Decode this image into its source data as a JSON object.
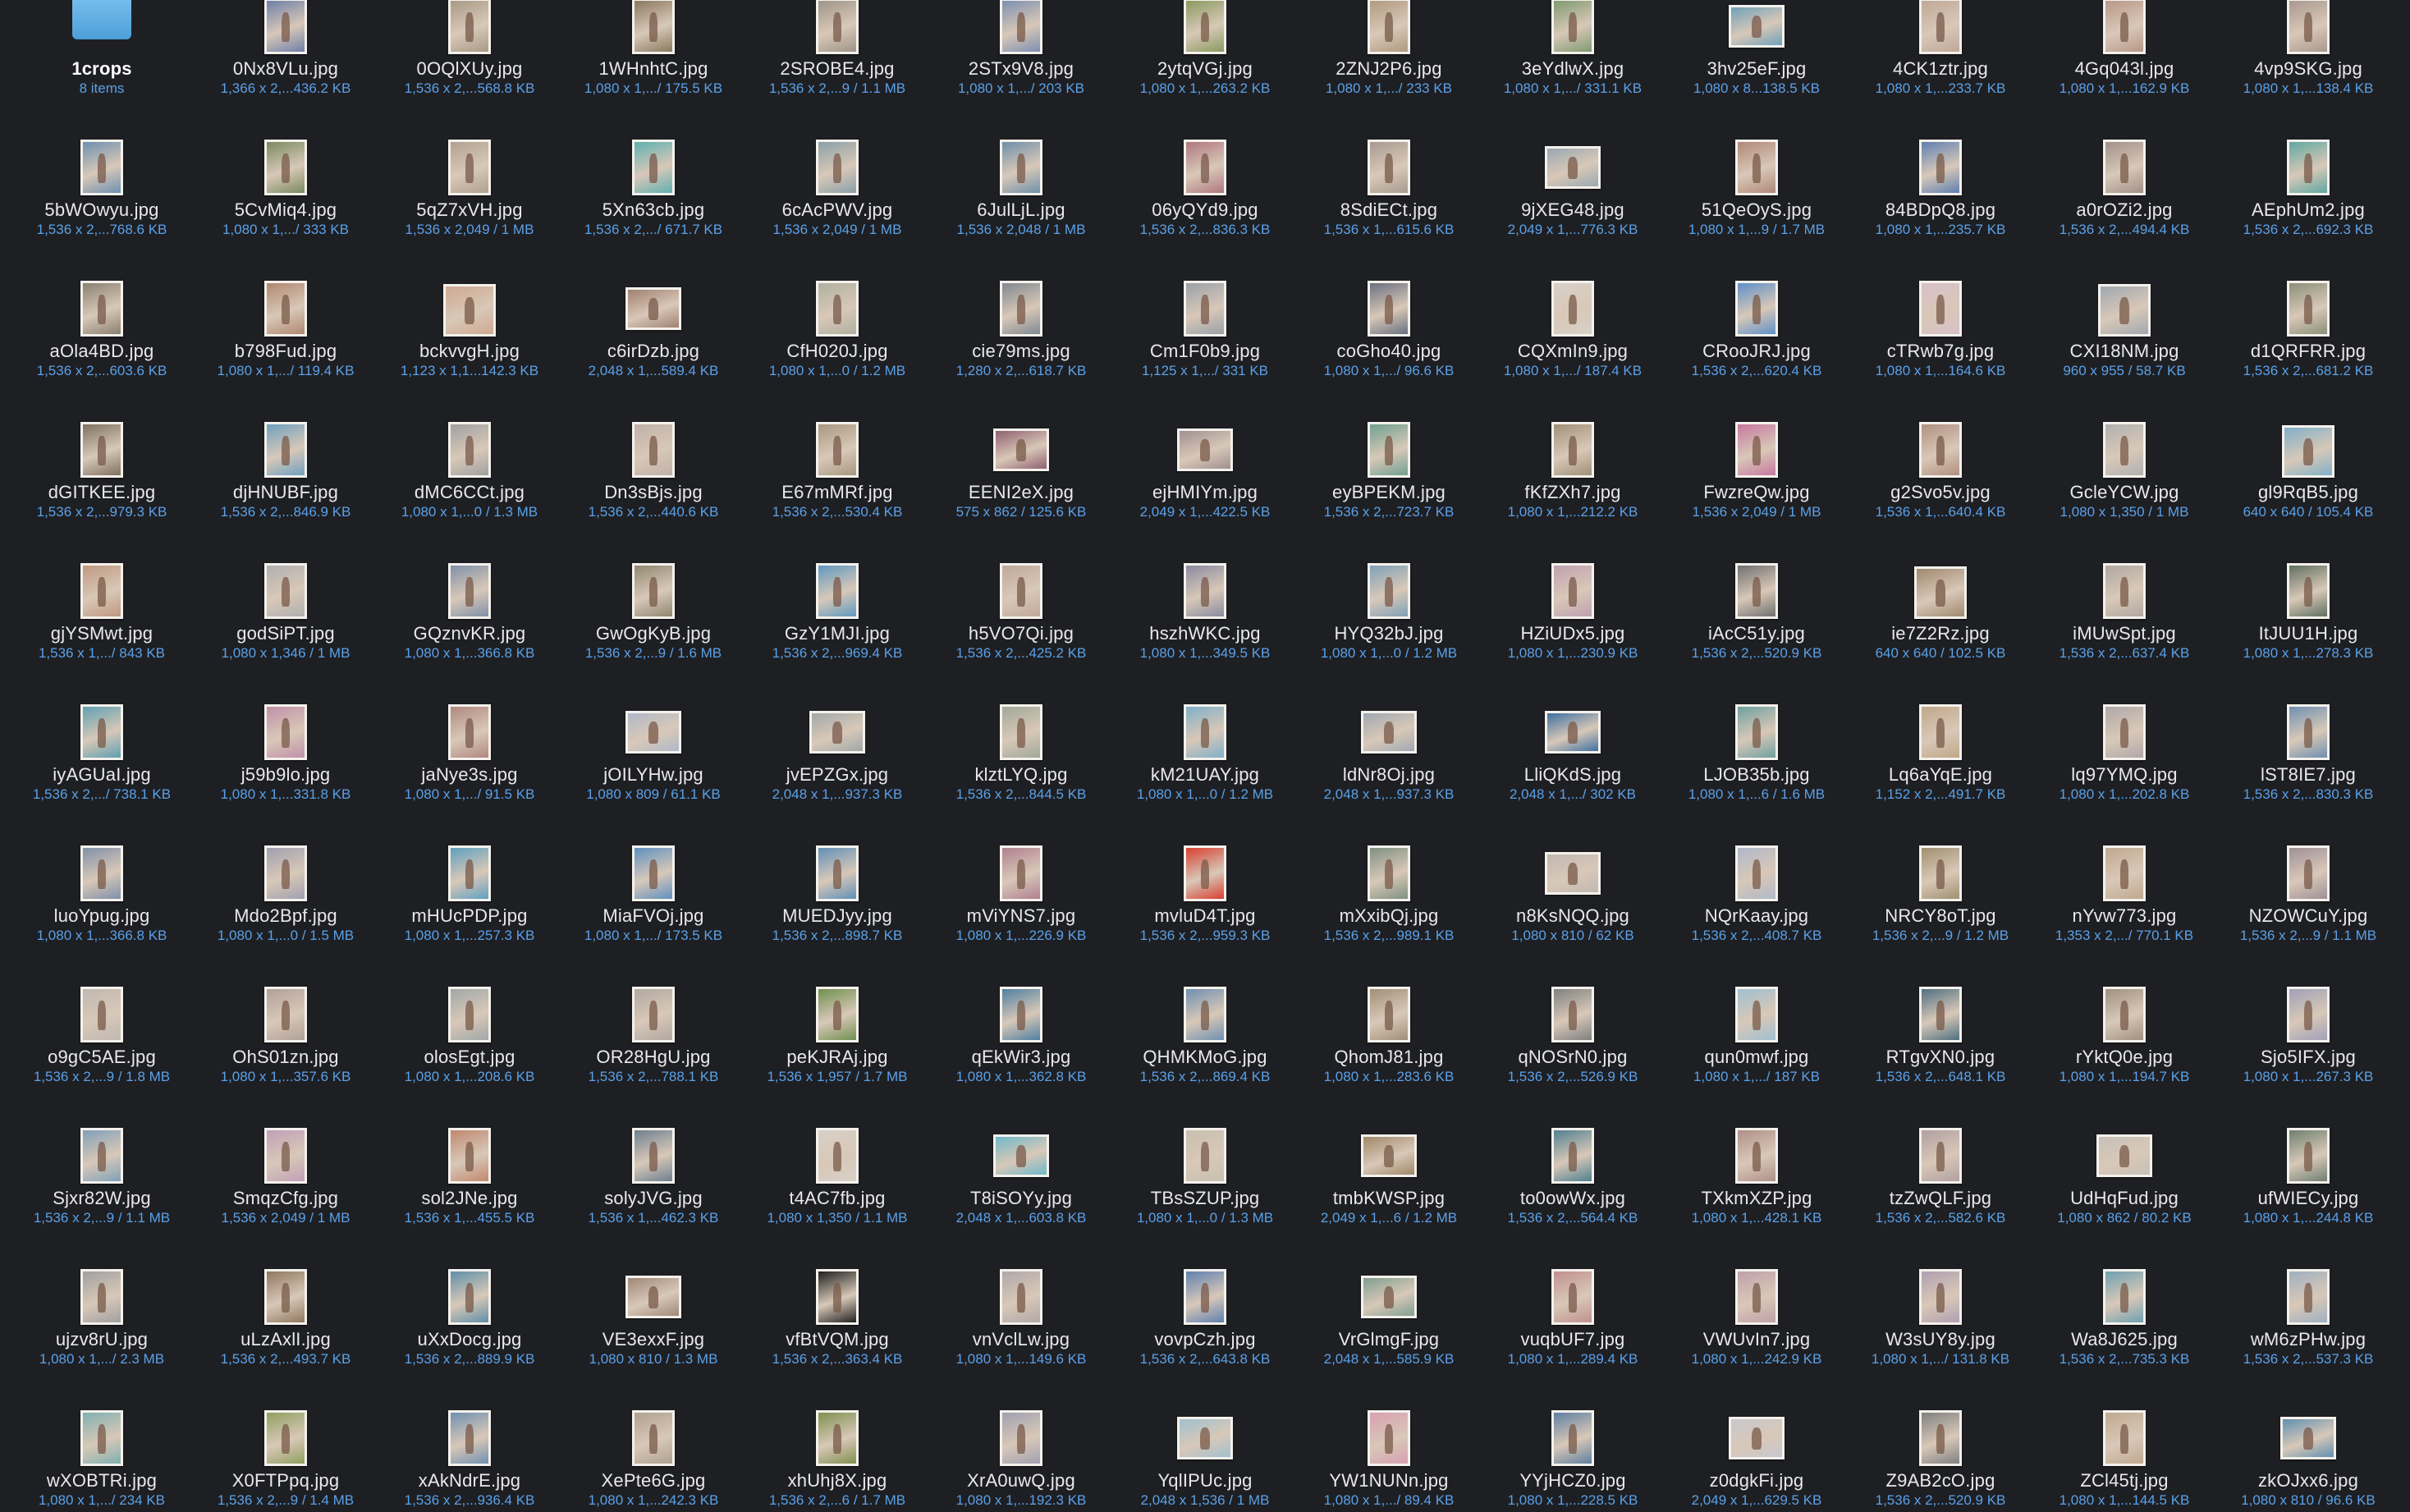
{
  "window": {
    "background": "#1e1f23",
    "name_color": "#e9e9eb",
    "meta_color": "#5aa1e8"
  },
  "folder": {
    "name": "1crops",
    "meta": "8 items",
    "icon": "folder-icon"
  },
  "files": [
    {
      "name": "0Nx8VLu.jpg",
      "meta": "1,366 x 2,...436.2 KB",
      "c": "#6f7fa8"
    },
    {
      "name": "0OQlXUy.jpg",
      "meta": "1,536 x 2,...568.8 KB",
      "c": "#a89a86"
    },
    {
      "name": "1WHnhtC.jpg",
      "meta": "1,080 x 1,.../ 175.5 KB",
      "c": "#8a7a60"
    },
    {
      "name": "2SROBE4.jpg",
      "meta": "1,536 x 2,...9 / 1.1 MB",
      "c": "#9e9488"
    },
    {
      "name": "2STx9V8.jpg",
      "meta": "1,080 x 1,.../ 203 KB",
      "c": "#7d8fb0"
    },
    {
      "name": "2ytqVGj.jpg",
      "meta": "1,080 x 1,...263.2 KB",
      "c": "#8a9a60"
    },
    {
      "name": "2ZNJ2P6.jpg",
      "meta": "1,080 x 1,.../ 233 KB",
      "c": "#b09a80"
    },
    {
      "name": "3eYdlwX.jpg",
      "meta": "1,080 x 1,.../ 331.1 KB",
      "c": "#7f9a70"
    },
    {
      "name": "3hv25eF.jpg",
      "meta": "1,080 x 8...138.5 KB",
      "c": "#6fa0b8"
    },
    {
      "name": "4CK1ztr.jpg",
      "meta": "1,080 x 1,...233.7 KB",
      "c": "#c0a898"
    },
    {
      "name": "4Gq043l.jpg",
      "meta": "1,080 x 1,...162.9 KB",
      "c": "#b89888"
    },
    {
      "name": "4vp9SKG.jpg",
      "meta": "1,080 x 1,...138.4 KB",
      "c": "#a89890"
    },
    {
      "name": "5bWOwyu.jpg",
      "meta": "1,536 x 2,...768.6 KB",
      "c": "#6f90b0"
    },
    {
      "name": "5CvMiq4.jpg",
      "meta": "1,080 x 1,.../ 333 KB",
      "c": "#7a8a60"
    },
    {
      "name": "5qZ7xVH.jpg",
      "meta": "1,536 x 2,049 / 1 MB",
      "c": "#b0a090"
    },
    {
      "name": "5Xn63cb.jpg",
      "meta": "1,536 x 2,.../ 671.7 KB",
      "c": "#5fb0b0"
    },
    {
      "name": "6cAcPWV.jpg",
      "meta": "1,536 x 2,049 / 1 MB",
      "c": "#8aa0a8"
    },
    {
      "name": "6JulLjL.jpg",
      "meta": "1,536 x 2,048 / 1 MB",
      "c": "#6f90a8"
    },
    {
      "name": "06yQYd9.jpg",
      "meta": "1,536 x 2,...836.3 KB",
      "c": "#b07880"
    },
    {
      "name": "8SdiECt.jpg",
      "meta": "1,536 x 1,...615.6 KB",
      "c": "#a89a90"
    },
    {
      "name": "9jXEG48.jpg",
      "meta": "2,049 x 1,...776.3 KB",
      "c": "#9aa8b0"
    },
    {
      "name": "51QeOyS.jpg",
      "meta": "1,080 x 1,...9 / 1.7 MB",
      "c": "#b08878"
    },
    {
      "name": "84BDpQ8.jpg",
      "meta": "1,080 x 1,...235.7 KB",
      "c": "#5f80b0"
    },
    {
      "name": "a0rOZi2.jpg",
      "meta": "1,536 x 2,...494.4 KB",
      "c": "#a09088"
    },
    {
      "name": "AEphUm2.jpg",
      "meta": "1,536 x 2,...692.3 KB",
      "c": "#60a8a0"
    },
    {
      "name": "aOla4BD.jpg",
      "meta": "1,536 x 2,...603.6 KB",
      "c": "#8a8070"
    },
    {
      "name": "b798Fud.jpg",
      "meta": "1,080 x 1,.../ 119.4 KB",
      "c": "#b08870"
    },
    {
      "name": "bckvvgH.jpg",
      "meta": "1,123 x 1,1...142.3 KB",
      "c": "#d0a890"
    },
    {
      "name": "c6irDzb.jpg",
      "meta": "2,048 x 1,...589.4 KB",
      "c": "#a08070"
    },
    {
      "name": "CfH020J.jpg",
      "meta": "1,080 x 1,...0 / 1.2 MB",
      "c": "#b0b0a0"
    },
    {
      "name": "cie79ms.jpg",
      "meta": "1,280 x 2,...618.7 KB",
      "c": "#808890"
    },
    {
      "name": "Cm1F0b9.jpg",
      "meta": "1,125 x 1,.../ 331 KB",
      "c": "#9aa0a8"
    },
    {
      "name": "coGho40.jpg",
      "meta": "1,080 x 1,.../ 96.6 KB",
      "c": "#6a7080"
    },
    {
      "name": "CQXmIn9.jpg",
      "meta": "1,080 x 1,.../ 187.4 KB",
      "c": "#d8d0c8"
    },
    {
      "name": "CRooJRJ.jpg",
      "meta": "1,536 x 2,...620.4 KB",
      "c": "#5f90c8"
    },
    {
      "name": "cTRwb7g.jpg",
      "meta": "1,080 x 1,...164.6 KB",
      "c": "#d8c0c8"
    },
    {
      "name": "CXI18NM.jpg",
      "meta": "960 x 955 / 58.7 KB",
      "c": "#a0a8b0"
    },
    {
      "name": "d1QRFRR.jpg",
      "meta": "1,536 x 2,...681.2 KB",
      "c": "#8a9078"
    },
    {
      "name": "dGITKEE.jpg",
      "meta": "1,536 x 2,...979.3 KB",
      "c": "#807060"
    },
    {
      "name": "djHNUBF.jpg",
      "meta": "1,536 x 2,...846.9 KB",
      "c": "#6fa0c0"
    },
    {
      "name": "dMC6CCt.jpg",
      "meta": "1,080 x 1,...0 / 1.3 MB",
      "c": "#a0a0a0"
    },
    {
      "name": "Dn3sBjs.jpg",
      "meta": "1,536 x 2,...440.6 KB",
      "c": "#c0b0a8"
    },
    {
      "name": "E67mMRf.jpg",
      "meta": "1,536 x 2,...530.4 KB",
      "c": "#a89880"
    },
    {
      "name": "EENI2eX.jpg",
      "meta": "575 x 862 / 125.6 KB",
      "c": "#906070"
    },
    {
      "name": "ejHMIYm.jpg",
      "meta": "2,049 x 1,...422.5 KB",
      "c": "#a09090"
    },
    {
      "name": "eyBPEKM.jpg",
      "meta": "1,536 x 2,...723.7 KB",
      "c": "#70a090"
    },
    {
      "name": "fKfZXh7.jpg",
      "meta": "1,080 x 1,...212.2 KB",
      "c": "#a09078"
    },
    {
      "name": "FwzreQw.jpg",
      "meta": "1,536 x 2,049 / 1 MB",
      "c": "#c878a0"
    },
    {
      "name": "g2Svo5v.jpg",
      "meta": "1,536 x 1,...640.4 KB",
      "c": "#b09080"
    },
    {
      "name": "GcleYCW.jpg",
      "meta": "1,080 x 1,350 / 1 MB",
      "c": "#b0b0b0"
    },
    {
      "name": "gl9RqB5.jpg",
      "meta": "640 x 640 / 105.4 KB",
      "c": "#80b0c8"
    },
    {
      "name": "gjYSMwt.jpg",
      "meta": "1,536 x 1,.../ 843 KB",
      "c": "#c09880"
    },
    {
      "name": "godSiPT.jpg",
      "meta": "1,080 x 1,346 / 1 MB",
      "c": "#b0b0b0"
    },
    {
      "name": "GQznvKR.jpg",
      "meta": "1,080 x 1,...366.8 KB",
      "c": "#8090a8"
    },
    {
      "name": "GwOgKyB.jpg",
      "meta": "1,536 x 2,...9 / 1.6 MB",
      "c": "#908870"
    },
    {
      "name": "GzY1MJI.jpg",
      "meta": "1,536 x 2,...969.4 KB",
      "c": "#5f98c0"
    },
    {
      "name": "h5VO7Qi.jpg",
      "meta": "1,536 x 2,...425.2 KB",
      "c": "#c0a898"
    },
    {
      "name": "hszhWKC.jpg",
      "meta": "1,080 x 1,...349.5 KB",
      "c": "#8a8aa0"
    },
    {
      "name": "HYQ32bJ.jpg",
      "meta": "1,080 x 1,...0 / 1.2 MB",
      "c": "#80a0b8"
    },
    {
      "name": "HZiUDx5.jpg",
      "meta": "1,080 x 1,...230.9 KB",
      "c": "#c0a0b0"
    },
    {
      "name": "iAcC51y.jpg",
      "meta": "1,536 x 2,...520.9 KB",
      "c": "#707070"
    },
    {
      "name": "ie7Z2Rz.jpg",
      "meta": "640 x 640 / 102.5 KB",
      "c": "#a08870"
    },
    {
      "name": "iMUwSpt.jpg",
      "meta": "1,536 x 2,...637.4 KB",
      "c": "#b0a8a0"
    },
    {
      "name": "ItJUU1H.jpg",
      "meta": "1,080 x 1,...278.3 KB",
      "c": "#607060"
    },
    {
      "name": "iyAGUaI.jpg",
      "meta": "1,536 x 2,.../ 738.1 KB",
      "c": "#60a0b0"
    },
    {
      "name": "j59b9lo.jpg",
      "meta": "1,080 x 1,...331.8 KB",
      "c": "#c090a8"
    },
    {
      "name": "jaNye3s.jpg",
      "meta": "1,080 x 1,.../ 91.5 KB",
      "c": "#b08880"
    },
    {
      "name": "jOILYHw.jpg",
      "meta": "1,080 x 809 / 61.1 KB",
      "c": "#b0b8c8"
    },
    {
      "name": "jvEPZGx.jpg",
      "meta": "2,048 x 1,...937.3 KB",
      "c": "#a0a8a8"
    },
    {
      "name": "klztLYQ.jpg",
      "meta": "1,536 x 2,...844.5 KB",
      "c": "#a0a898"
    },
    {
      "name": "kM21UAY.jpg",
      "meta": "1,080 x 1,...0 / 1.2 MB",
      "c": "#80b0c8"
    },
    {
      "name": "ldNr8Oj.jpg",
      "meta": "2,048 x 1,...937.3 KB",
      "c": "#a0a8b0"
    },
    {
      "name": "LliQKdS.jpg",
      "meta": "2,048 x 1,.../ 302 KB",
      "c": "#3f70a0"
    },
    {
      "name": "LJOB35b.jpg",
      "meta": "1,080 x 1,...6 / 1.6 MB",
      "c": "#70a0a0"
    },
    {
      "name": "Lq6aYqE.jpg",
      "meta": "1,152 x 2,...491.7 KB",
      "c": "#c0a888"
    },
    {
      "name": "lq97YMQ.jpg",
      "meta": "1,080 x 1,...202.8 KB",
      "c": "#b0a8a8"
    },
    {
      "name": "lST8IE7.jpg",
      "meta": "1,536 x 2,...830.3 KB",
      "c": "#7090b0"
    },
    {
      "name": "luoYpug.jpg",
      "meta": "1,080 x 1,...366.8 KB",
      "c": "#8090a8"
    },
    {
      "name": "Mdo2Bpf.jpg",
      "meta": "1,080 x 1,...0 / 1.5 MB",
      "c": "#a0a0b0"
    },
    {
      "name": "mHUcPDP.jpg",
      "meta": "1,080 x 1,...257.3 KB",
      "c": "#60a0c0"
    },
    {
      "name": "MiaFVOj.jpg",
      "meta": "1,080 x 1,.../ 173.5 KB",
      "c": "#5f90c0"
    },
    {
      "name": "MUEDJyy.jpg",
      "meta": "1,536 x 2,...898.7 KB",
      "c": "#6090b8"
    },
    {
      "name": "mViYNS7.jpg",
      "meta": "1,080 x 1,...226.9 KB",
      "c": "#b08090"
    },
    {
      "name": "mvluD4T.jpg",
      "meta": "1,536 x 2,...959.3 KB",
      "c": "#d84030"
    },
    {
      "name": "mXxibQj.jpg",
      "meta": "1,536 x 2,...989.1 KB",
      "c": "#809080"
    },
    {
      "name": "n8KsNQQ.jpg",
      "meta": "1,080 x 810 / 62 KB",
      "c": "#c0b8b0"
    },
    {
      "name": "NQrKaay.jpg",
      "meta": "1,536 x 2,...408.7 KB",
      "c": "#b0b8c8"
    },
    {
      "name": "NRCY8oT.jpg",
      "meta": "1,536 x 2,...9 / 1.2 MB",
      "c": "#a09070"
    },
    {
      "name": "nYvw773.jpg",
      "meta": "1,353 x 2,.../ 770.1 KB",
      "c": "#c0a890"
    },
    {
      "name": "NZOWCuY.jpg",
      "meta": "1,536 x 2,...9 / 1.1 MB",
      "c": "#a09098"
    },
    {
      "name": "o9gC5AE.jpg",
      "meta": "1,536 x 2,...9 / 1.8 MB",
      "c": "#c0b8b0"
    },
    {
      "name": "OhS01zn.jpg",
      "meta": "1,080 x 1,...357.6 KB",
      "c": "#b0a098"
    },
    {
      "name": "olosEgt.jpg",
      "meta": "1,080 x 1,...208.6 KB",
      "c": "#a0a8a8"
    },
    {
      "name": "OR28HgU.jpg",
      "meta": "1,536 x 2,...788.1 KB",
      "c": "#b0a8a0"
    },
    {
      "name": "peKJRAj.jpg",
      "meta": "1,536 x 1,957 / 1.7 MB",
      "c": "#709050"
    },
    {
      "name": "qEkWir3.jpg",
      "meta": "1,080 x 1,...362.8 KB",
      "c": "#5080a0"
    },
    {
      "name": "QHMKMoG.jpg",
      "meta": "1,536 x 2,...869.4 KB",
      "c": "#7090b0"
    },
    {
      "name": "QhomJ81.jpg",
      "meta": "1,080 x 1,...283.6 KB",
      "c": "#a09078"
    },
    {
      "name": "qNOSrN0.jpg",
      "meta": "1,536 x 2,...526.9 KB",
      "c": "#808080"
    },
    {
      "name": "qun0mwf.jpg",
      "meta": "1,080 x 1,.../ 187 KB",
      "c": "#a0c0d0"
    },
    {
      "name": "RTgvXN0.jpg",
      "meta": "1,536 x 2,...648.1 KB",
      "c": "#507080"
    },
    {
      "name": "rYktQ0e.jpg",
      "meta": "1,080 x 1,...194.7 KB",
      "c": "#a09080"
    },
    {
      "name": "Sjo5IFX.jpg",
      "meta": "1,080 x 1,...267.3 KB",
      "c": "#a0a0b8"
    },
    {
      "name": "Sjxr82W.jpg",
      "meta": "1,536 x 2,...9 / 1.1 MB",
      "c": "#80a0b8"
    },
    {
      "name": "SmqzCfg.jpg",
      "meta": "1,536 x 2,049 / 1 MB",
      "c": "#c0a0b8"
    },
    {
      "name": "sol2JNe.jpg",
      "meta": "1,536 x 1,...455.5 KB",
      "c": "#c08870"
    },
    {
      "name": "solyJVG.jpg",
      "meta": "1,536 x 1,...462.3 KB",
      "c": "#6f8090"
    },
    {
      "name": "t4AC7fb.jpg",
      "meta": "1,080 x 1,350 / 1.1 MB",
      "c": "#d8d0c8"
    },
    {
      "name": "T8iSOYy.jpg",
      "meta": "2,048 x 1,...603.8 KB",
      "c": "#70b8c8"
    },
    {
      "name": "TBsSZUP.jpg",
      "meta": "1,080 x 1,...0 / 1.3 MB",
      "c": "#c8c0b0"
    },
    {
      "name": "tmbKWSP.jpg",
      "meta": "2,049 x 1,...6 / 1.2 MB",
      "c": "#a08868"
    },
    {
      "name": "to0owWx.jpg",
      "meta": "1,536 x 2,...564.4 KB",
      "c": "#508090"
    },
    {
      "name": "TXkmXZP.jpg",
      "meta": "1,080 x 1,...428.1 KB",
      "c": "#b09088"
    },
    {
      "name": "tzZwQLF.jpg",
      "meta": "1,536 x 2,...582.6 KB",
      "c": "#b0a0a0"
    },
    {
      "name": "UdHqFud.jpg",
      "meta": "1,080 x 862 / 80.2 KB",
      "c": "#c8c0b8"
    },
    {
      "name": "ufWIECy.jpg",
      "meta": "1,080 x 1,...244.8 KB",
      "c": "#708070"
    },
    {
      "name": "ujzv8rU.jpg",
      "meta": "1,080 x 1,.../ 2.3 MB",
      "c": "#a0a0a0"
    },
    {
      "name": "uLzAxlI.jpg",
      "meta": "1,536 x 2,...493.7 KB",
      "c": "#907860"
    },
    {
      "name": "uXxDocg.jpg",
      "meta": "1,536 x 2,...889.9 KB",
      "c": "#6090a8"
    },
    {
      "name": "VE3exxF.jpg",
      "meta": "1,080 x 810 / 1.3 MB",
      "c": "#a08878"
    },
    {
      "name": "vfBtVQM.jpg",
      "meta": "1,536 x 2,...363.4 KB",
      "c": "#202020"
    },
    {
      "name": "vnVclLw.jpg",
      "meta": "1,080 x 1,...149.6 KB",
      "c": "#b0a8a8"
    },
    {
      "name": "vovpCzh.jpg",
      "meta": "1,536 x 2,...643.8 KB",
      "c": "#6080b0"
    },
    {
      "name": "VrGlmgF.jpg",
      "meta": "2,048 x 1,...585.9 KB",
      "c": "#80a090"
    },
    {
      "name": "vuqbUF7.jpg",
      "meta": "1,080 x 1,...289.4 KB",
      "c": "#c09090"
    },
    {
      "name": "VWUvIn7.jpg",
      "meta": "1,080 x 1,...242.9 KB",
      "c": "#c0a0a8"
    },
    {
      "name": "W3sUY8y.jpg",
      "meta": "1,080 x 1,.../ 131.8 KB",
      "c": "#b0a0b0"
    },
    {
      "name": "Wa8J625.jpg",
      "meta": "1,536 x 2,...735.3 KB",
      "c": "#70a0b0"
    },
    {
      "name": "wM6zPHw.jpg",
      "meta": "1,536 x 2,...537.3 KB",
      "c": "#a0b0c0"
    },
    {
      "name": "wXOBTRi.jpg",
      "meta": "1,080 x 1,.../ 234 KB",
      "c": "#80b0b0"
    },
    {
      "name": "X0FTPpq.jpg",
      "meta": "1,536 x 2,...9 / 1.4 MB",
      "c": "#90a060"
    },
    {
      "name": "xAkNdrE.jpg",
      "meta": "1,536 x 2,...936.4 KB",
      "c": "#7090b0"
    },
    {
      "name": "XePte6G.jpg",
      "meta": "1,080 x 1,...242.3 KB",
      "c": "#b0a090"
    },
    {
      "name": "xhUhj8X.jpg",
      "meta": "1,536 x 2,...6 / 1.7 MB",
      "c": "#809050"
    },
    {
      "name": "XrA0uwQ.jpg",
      "meta": "1,080 x 1,...192.3 KB",
      "c": "#a0a0b0"
    },
    {
      "name": "YqlIPUc.jpg",
      "meta": "2,048 x 1,536 / 1 MB",
      "c": "#a0c0d0"
    },
    {
      "name": "YW1NUNn.jpg",
      "meta": "1,080 x 1,.../ 89.4 KB",
      "c": "#d8a0b0"
    },
    {
      "name": "YYjHCZ0.jpg",
      "meta": "1,080 x 1,...228.5 KB",
      "c": "#6080a0"
    },
    {
      "name": "z0dgkFi.jpg",
      "meta": "2,049 x 1,...629.5 KB",
      "c": "#c8c8d0"
    },
    {
      "name": "Z9AB2cO.jpg",
      "meta": "1,536 x 2,...520.9 KB",
      "c": "#808080"
    },
    {
      "name": "ZCl45tj.jpg",
      "meta": "1,080 x 1,...144.5 KB",
      "c": "#c0a890"
    },
    {
      "name": "zkOJxx6.jpg",
      "meta": "1,080 x 810 / 96.6 KB",
      "c": "#6090b0"
    }
  ]
}
